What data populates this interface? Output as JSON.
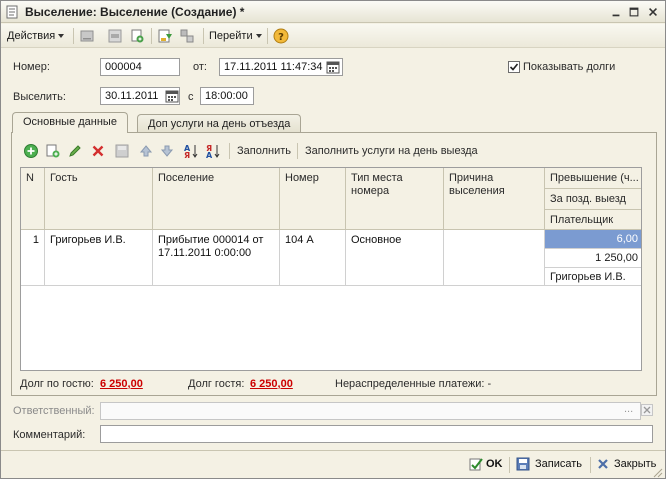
{
  "window": {
    "title": "Выселение: Выселение (Создание) *"
  },
  "toolbar": {
    "actions_label": "Действия",
    "goto_label": "Перейти"
  },
  "form": {
    "number_label": "Номер:",
    "number_value": "000004",
    "from_label": "от:",
    "from_value": "17.11.2011 11:47:34",
    "show_debts_label": "Показывать долги",
    "show_debts_checked": true,
    "evict_label": "Выселить:",
    "evict_date": "30.11.2011",
    "time_label": "с",
    "evict_time": "18:00:00"
  },
  "tabs": [
    {
      "label": "Основные данные",
      "active": true
    },
    {
      "label": "Доп услуги на день отъезда",
      "active": false
    }
  ],
  "grid_toolbar": {
    "fill_label": "Заполнить",
    "fill_services_label": "Заполнить услуги на день выезда"
  },
  "grid": {
    "columns": [
      "N",
      "Гость",
      "Поселение",
      "Номер",
      "Тип места номера",
      "Причина выселения"
    ],
    "extra_columns": [
      "Превышение (ч...",
      "За позд. выезд",
      "Плательщик"
    ],
    "rows": [
      {
        "n": "1",
        "guest": "Григорьев И.В.",
        "settlement": "Прибытие 000014 от 17.11.2011 0:00:00",
        "room": "104 А",
        "place_type": "Основное",
        "reason": "",
        "excess": "6,00",
        "late_checkout": "1 250,00",
        "payer": "Григорьев И.В."
      }
    ]
  },
  "summary": {
    "guest_debt_label": "Долг по гостю:",
    "guest_debt_value": "6 250,00",
    "guest_debt2_label": "Долг гостя:",
    "guest_debt2_value": "6 250,00",
    "unallocated_label": "Нераспределенные платежи: -"
  },
  "bottom": {
    "responsible_label": "Ответственный:",
    "responsible_value": "",
    "comment_label": "Комментарий:",
    "comment_value": ""
  },
  "buttons": {
    "ok_label": "OK",
    "save_label": "Записать",
    "close_label": "Закрыть"
  },
  "colors": {
    "selection": "#7b9bd1",
    "debt": "#cc0000"
  }
}
